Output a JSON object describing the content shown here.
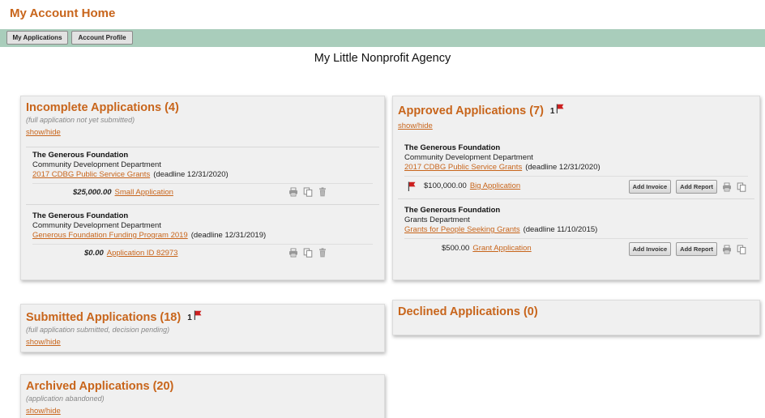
{
  "header": {
    "title": "My Account Home"
  },
  "nav": {
    "tabs": [
      {
        "label": "My Applications"
      },
      {
        "label": "Account Profile"
      }
    ]
  },
  "org_name": "My Little Nonprofit Agency",
  "colors": {
    "accent": "#c8651b",
    "navbar": "#a9cdbb",
    "flag": "#cc1f1f"
  },
  "incomplete": {
    "title": "Incomplete Applications (4)",
    "note": "(full application not yet submitted)",
    "toggle": "show/hide",
    "entries": [
      {
        "funder": "The Generous Foundation",
        "dept": "Community Development Department",
        "program": "2017 CDBG Public Service Grants",
        "deadline": "(deadline 12/31/2020)",
        "amount": "$25,000.00",
        "app": "Small Application"
      },
      {
        "funder": "The Generous Foundation",
        "dept": "Community Development Department",
        "program": "Generous Foundation Funding Program 2019",
        "deadline": "(deadline 12/31/2019)",
        "amount": "$0.00",
        "app": "Application ID 82973"
      }
    ]
  },
  "approved": {
    "title": "Approved Applications (7)",
    "flag_count": "1",
    "toggle": "show/hide",
    "entries": [
      {
        "funder": "The Generous Foundation",
        "dept": "Community Development Department",
        "program": "2017 CDBG Public Service Grants",
        "deadline": "(deadline 12/31/2020)",
        "amount": "$100,000.00",
        "app": "Big Application"
      },
      {
        "funder": "The Generous Foundation",
        "dept": "Grants Department",
        "program": "Grants for People Seeking Grants",
        "deadline": "(deadline 11/10/2015)",
        "amount": "$500.00",
        "app": "Grant Application"
      }
    ],
    "add_invoice": "Add Invoice",
    "add_report": "Add Report"
  },
  "submitted": {
    "title": "Submitted Applications (18)",
    "flag_count": "1",
    "note": "(full application submitted, decision pending)",
    "toggle": "show/hide"
  },
  "declined": {
    "title": "Declined Applications (0)"
  },
  "archived": {
    "title": "Archived Applications (20)",
    "note": "(application abandoned)",
    "toggle": "show/hide"
  }
}
